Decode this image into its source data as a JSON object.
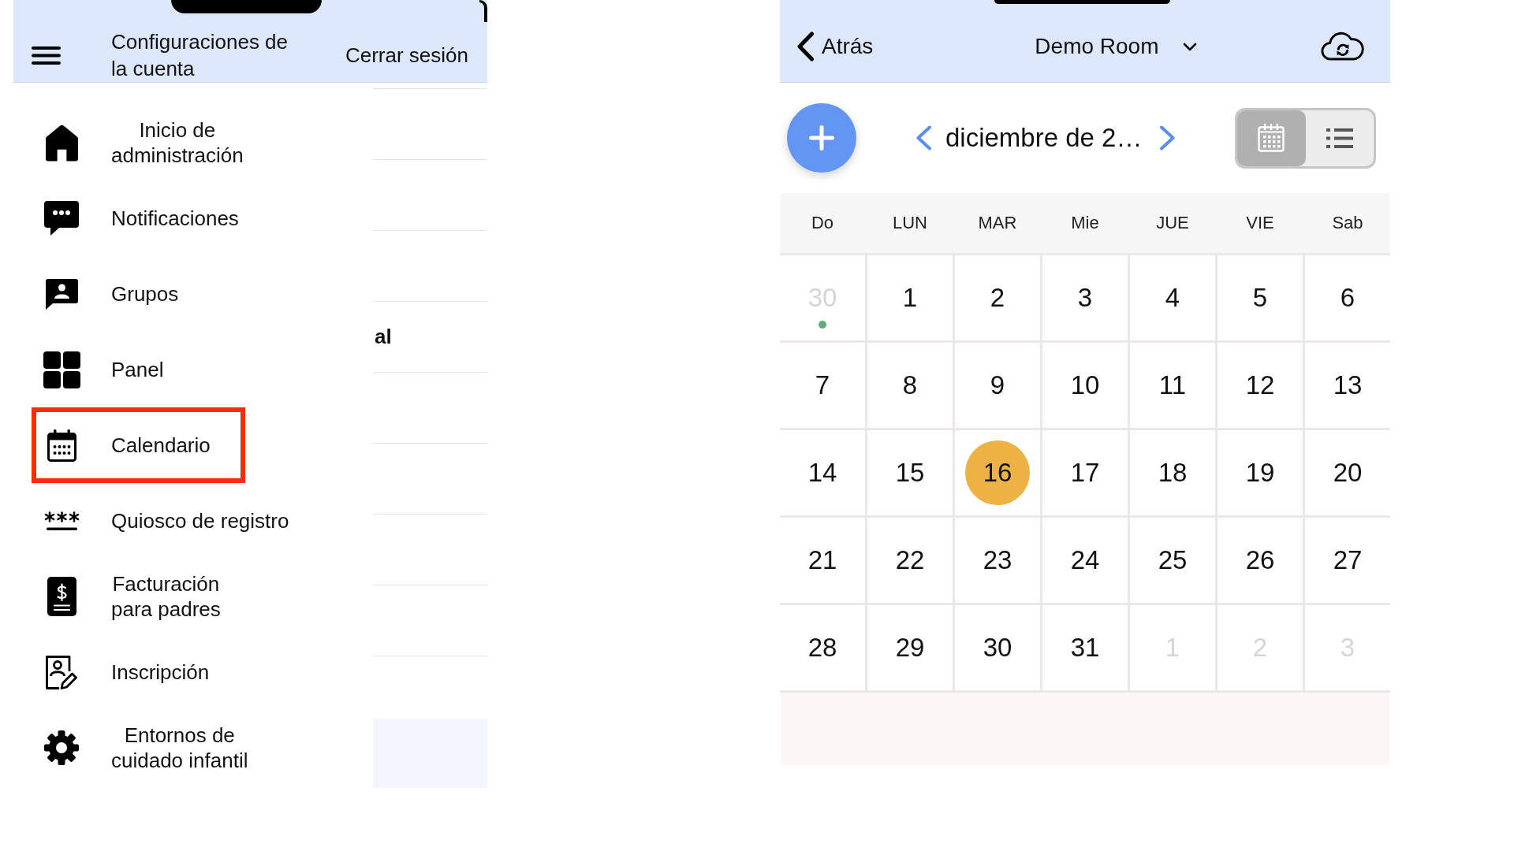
{
  "left_screen": {
    "header": {
      "title": "Configuraciones de\nla cuenta",
      "logout": "Cerrar sesión"
    },
    "menu": [
      {
        "kind": "home",
        "label": "Inicio de\nadministración",
        "highlighted": false
      },
      {
        "kind": "chat",
        "label": "Notificaciones",
        "highlighted": false
      },
      {
        "kind": "groups",
        "label": "Grupos",
        "highlighted": false
      },
      {
        "kind": "dashboard",
        "label": "Panel",
        "highlighted": false
      },
      {
        "kind": "calendar",
        "label": "Calendario",
        "highlighted": true
      },
      {
        "kind": "kiosk",
        "label": "Quiosco de registro",
        "highlighted": false
      },
      {
        "kind": "billing",
        "label": "Facturación\npara padres",
        "highlighted": false
      },
      {
        "kind": "enrollment",
        "label": "Inscripción",
        "highlighted": false
      },
      {
        "kind": "settings",
        "label": "Entornos de\ncuidado infantil",
        "highlighted": false
      }
    ],
    "background_page": {
      "row_text": "al"
    }
  },
  "right_screen": {
    "header": {
      "back": "Atrás",
      "room": "Demo Room"
    },
    "toolbar": {
      "month": "diciembre de 2…",
      "views": [
        {
          "kind": "calendar",
          "selected": true
        },
        {
          "kind": "list",
          "selected": false
        }
      ]
    },
    "weekdays": [
      "Do",
      "LUN",
      "MAR",
      "Mie",
      "JUE",
      "VIE",
      "Sab"
    ],
    "weeks": [
      [
        {
          "day": "30",
          "muted": true,
          "selected": false,
          "event": true
        },
        {
          "day": "1",
          "muted": false,
          "selected": false,
          "event": false
        },
        {
          "day": "2",
          "muted": false,
          "selected": false,
          "event": false
        },
        {
          "day": "3",
          "muted": false,
          "selected": false,
          "event": false
        },
        {
          "day": "4",
          "muted": false,
          "selected": false,
          "event": false
        },
        {
          "day": "5",
          "muted": false,
          "selected": false,
          "event": false
        },
        {
          "day": "6",
          "muted": false,
          "selected": false,
          "event": false
        }
      ],
      [
        {
          "day": "7",
          "muted": false,
          "selected": false,
          "event": false
        },
        {
          "day": "8",
          "muted": false,
          "selected": false,
          "event": false
        },
        {
          "day": "9",
          "muted": false,
          "selected": false,
          "event": false
        },
        {
          "day": "10",
          "muted": false,
          "selected": false,
          "event": false
        },
        {
          "day": "11",
          "muted": false,
          "selected": false,
          "event": false
        },
        {
          "day": "12",
          "muted": false,
          "selected": false,
          "event": false
        },
        {
          "day": "13",
          "muted": false,
          "selected": false,
          "event": false
        }
      ],
      [
        {
          "day": "14",
          "muted": false,
          "selected": false,
          "event": false
        },
        {
          "day": "15",
          "muted": false,
          "selected": false,
          "event": false
        },
        {
          "day": "16",
          "muted": false,
          "selected": true,
          "event": false
        },
        {
          "day": "17",
          "muted": false,
          "selected": false,
          "event": false
        },
        {
          "day": "18",
          "muted": false,
          "selected": false,
          "event": false
        },
        {
          "day": "19",
          "muted": false,
          "selected": false,
          "event": false
        },
        {
          "day": "20",
          "muted": false,
          "selected": false,
          "event": false
        }
      ],
      [
        {
          "day": "21",
          "muted": false,
          "selected": false,
          "event": false
        },
        {
          "day": "22",
          "muted": false,
          "selected": false,
          "event": false
        },
        {
          "day": "23",
          "muted": false,
          "selected": false,
          "event": false
        },
        {
          "day": "24",
          "muted": false,
          "selected": false,
          "event": false
        },
        {
          "day": "25",
          "muted": false,
          "selected": false,
          "event": false
        },
        {
          "day": "26",
          "muted": false,
          "selected": false,
          "event": false
        },
        {
          "day": "27",
          "muted": false,
          "selected": false,
          "event": false
        }
      ],
      [
        {
          "day": "28",
          "muted": false,
          "selected": false,
          "event": false
        },
        {
          "day": "29",
          "muted": false,
          "selected": false,
          "event": false
        },
        {
          "day": "30",
          "muted": false,
          "selected": false,
          "event": false
        },
        {
          "day": "31",
          "muted": false,
          "selected": false,
          "event": false
        },
        {
          "day": "1",
          "muted": true,
          "selected": false,
          "event": false
        },
        {
          "day": "2",
          "muted": true,
          "selected": false,
          "event": false
        },
        {
          "day": "3",
          "muted": true,
          "selected": false,
          "event": false
        }
      ]
    ]
  }
}
